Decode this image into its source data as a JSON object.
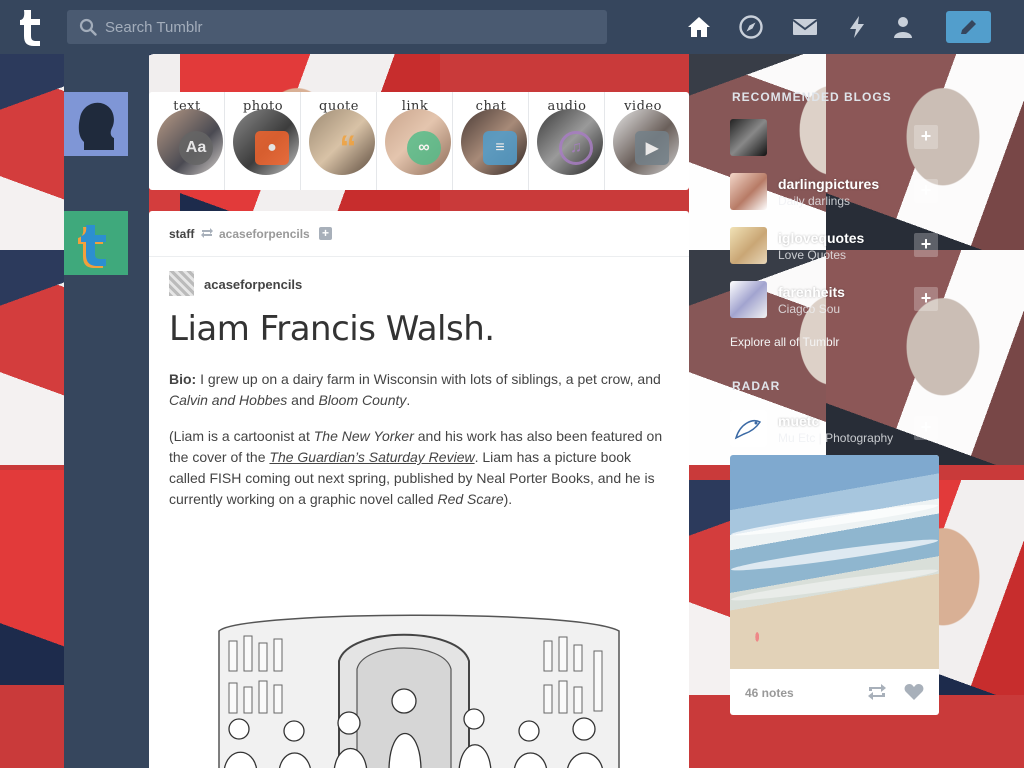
{
  "app": {
    "search_placeholder": "Search Tumblr",
    "icons": [
      "tumblr-logo-icon",
      "home-icon",
      "explore-compass-icon",
      "inbox-mail-icon",
      "activity-lightning-icon",
      "account-person-icon",
      "compose-pencil-icon"
    ],
    "colors": {
      "topbar": "#36465d",
      "compose": "#529ecc",
      "staff_avatar": "#3fa97c"
    }
  },
  "post_types": [
    {
      "label": "text",
      "color": "#666"
    },
    {
      "label": "photo",
      "color": "#f2642d"
    },
    {
      "label": "quote",
      "color": "#f1a23c"
    },
    {
      "label": "link",
      "color": "#56bc8a"
    },
    {
      "label": "chat",
      "color": "#529ecc"
    },
    {
      "label": "audio",
      "color": "#a77dc2"
    },
    {
      "label": "video",
      "color": "#748089"
    }
  ],
  "post": {
    "reblogger": "staff",
    "source": "acaseforpencils",
    "author": "acaseforpencils",
    "title": "Liam Francis Walsh.",
    "bio_label": "Bio:",
    "bio_1": " I grew up on a dairy farm in Wisconsin with lots of siblings, a pet crow, and ",
    "bio_em1": "Calvin and Hobbes",
    "bio_2": " and ",
    "bio_em2": "Bloom County",
    "bio_3": ".",
    "p2_1": "(Liam is a cartoonist at ",
    "p2_em1": "The New Yorker",
    "p2_2": " and his work has also been featured on the cover of the ",
    "p2_link": "The Guardian’s Saturday Review",
    "p2_3": ". Liam has a picture book called FISH coming out next spring, published by Neal Porter Books, and he is currently working on a graphic novel called ",
    "p2_em2": "Red Scare",
    "p2_4": ")."
  },
  "sidebar": {
    "recommended_heading": "RECOMMENDED BLOGS",
    "blogs": [
      {
        "name": "",
        "sub": ""
      },
      {
        "name": "darlingpictures",
        "sub": "Daily darlings"
      },
      {
        "name": "iglovequotes",
        "sub": "Love Quotes"
      },
      {
        "name": "farenheits",
        "sub": "Ciagco Sou"
      }
    ],
    "explore": "Explore all of Tumblr",
    "radar_heading": "RADAR",
    "radar": {
      "name": "muetc",
      "sub": "Mu Etc | Photography",
      "notes": "46 notes"
    }
  }
}
